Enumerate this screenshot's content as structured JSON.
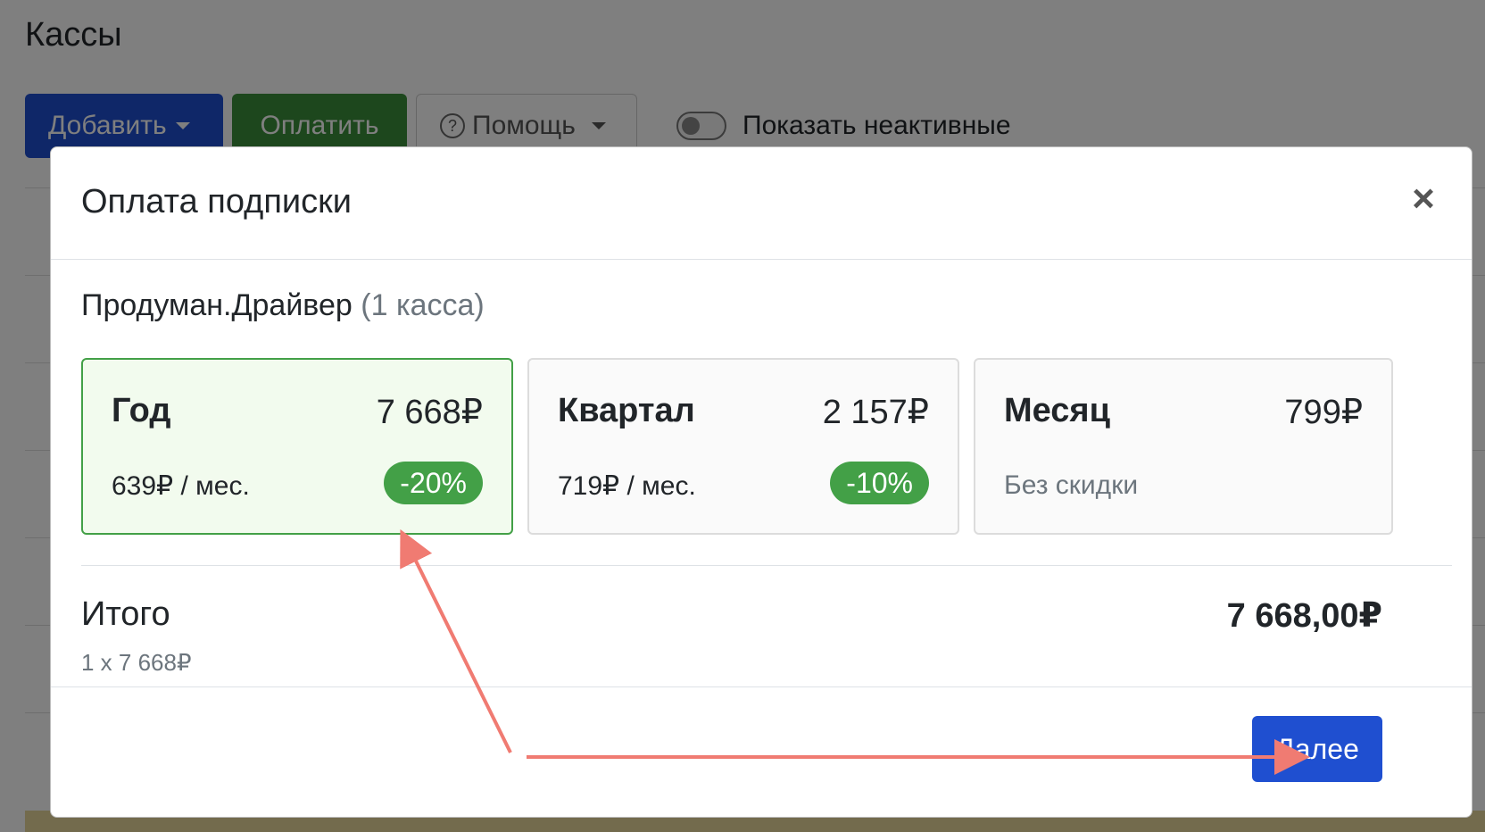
{
  "page": {
    "title": "Кассы",
    "toolbar": {
      "add_label": "Добавить",
      "pay_label": "Оплатить",
      "help_label": "Помощь",
      "help_icon_glyph": "?",
      "show_inactive_label": "Показать неактивные"
    }
  },
  "modal": {
    "title": "Оплата подписки",
    "close_glyph": "×",
    "product_name": "Продуман.Драйвер",
    "product_count": "(1 касса)",
    "plans": [
      {
        "name": "Год",
        "price": "7 668₽",
        "per_month": "639₽ / мес.",
        "discount": "-20%",
        "selected": true
      },
      {
        "name": "Квартал",
        "price": "2 157₽",
        "per_month": "719₽ / мес.",
        "discount": "-10%",
        "selected": false
      },
      {
        "name": "Месяц",
        "price": "799₽",
        "note": "Без скидки",
        "selected": false
      }
    ],
    "total": {
      "label": "Итого",
      "breakdown": "1 x 7 668₽",
      "value": "7 668,00₽"
    },
    "next_label": "Далее"
  },
  "colors": {
    "primary": "#1f4fd0",
    "success": "#43a047",
    "selected_bg": "#f2fbee",
    "annotation_arrow": "#f07b72"
  }
}
